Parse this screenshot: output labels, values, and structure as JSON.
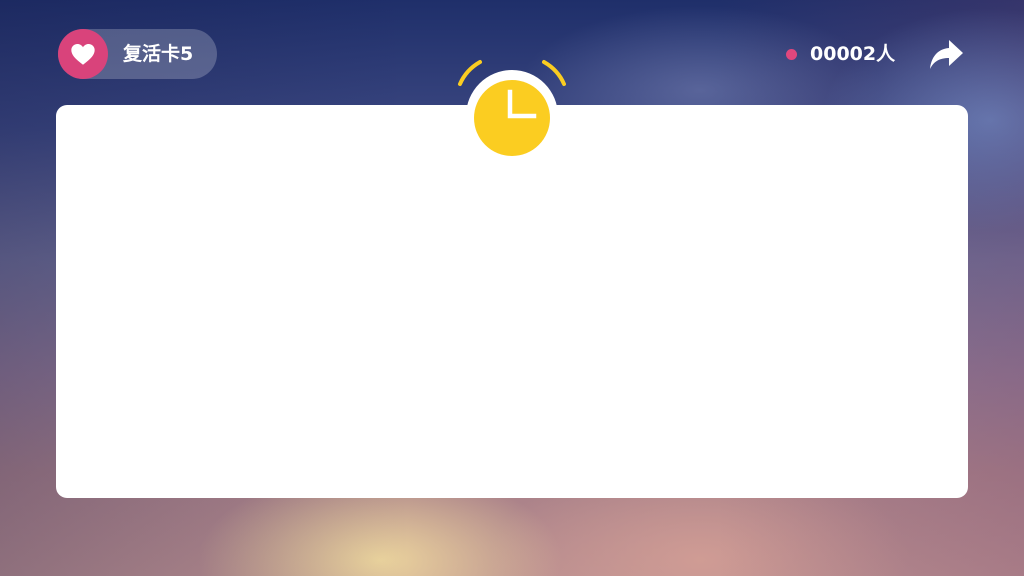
{
  "header": {
    "revive_card_label": "复活卡5",
    "online_count": "00002人"
  },
  "icons": {
    "revive": "heart-icon",
    "online_indicator": "status-dot",
    "share": "share-arrow-icon",
    "timer": "alarm-clock-icon"
  },
  "colors": {
    "heart_badge": "#d9437b",
    "online_dot": "#e1477d",
    "clock_face": "#fbcd21",
    "card": "#ffffff"
  }
}
